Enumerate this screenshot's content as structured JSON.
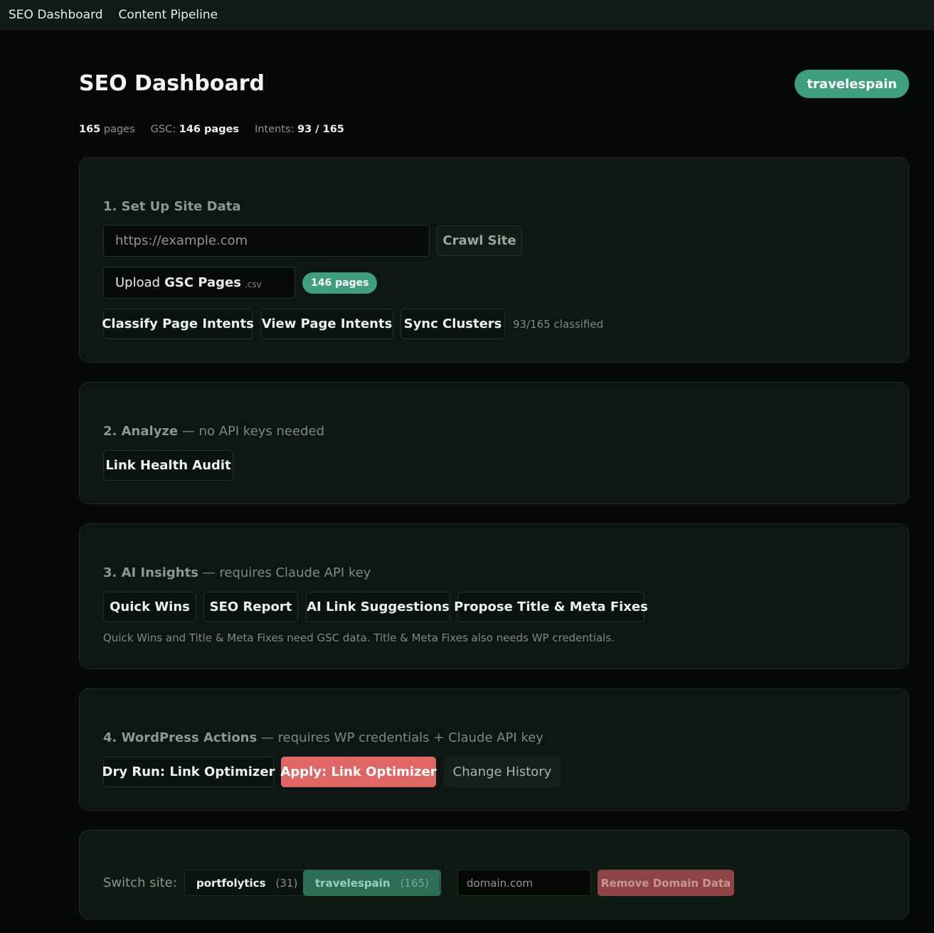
{
  "nav": {
    "items": [
      "SEO Dashboard",
      "Content Pipeline"
    ]
  },
  "header": {
    "title": "SEO Dashboard",
    "site_badge": "travelespain"
  },
  "stats": {
    "pages_count": "165",
    "pages_label": "pages",
    "gsc_label": "GSC:",
    "gsc_value": "146 pages",
    "intents_label": "Intents:",
    "intents_value": "93 / 165"
  },
  "setup": {
    "title": "1. Set Up Site Data",
    "url_placeholder": "https://example.com",
    "crawl_button": "Crawl Site",
    "upload_prefix": "Upload",
    "upload_strong": "GSC Pages",
    "upload_ext": ".csv",
    "pages_badge": "146 pages",
    "classify_button": "Classify Page Intents",
    "view_button": "View Page Intents",
    "sync_button": "Sync Clusters",
    "classified_note": "93/165 classified"
  },
  "analyze": {
    "title": "2. Analyze",
    "subtitle": "— no API keys needed",
    "link_health_button": "Link Health Audit"
  },
  "ai": {
    "title": "3. AI Insights",
    "subtitle": "— requires Claude API key",
    "buttons": [
      "Quick Wins",
      "SEO Report",
      "AI Link Suggestions",
      "Propose Title & Meta Fixes"
    ],
    "note": "Quick Wins and Title & Meta Fixes need GSC data. Title & Meta Fixes also needs WP credentials."
  },
  "wordpress": {
    "title": "4. WordPress Actions",
    "subtitle": "— requires WP credentials + Claude API key",
    "dry_run_button": "Dry Run: Link Optimizer",
    "apply_button": "Apply: Link Optimizer",
    "history_button": "Change History"
  },
  "switcher": {
    "label": "Switch site:",
    "sites": [
      {
        "name": "portfolytics",
        "count": "(31)"
      },
      {
        "name": "travelespain",
        "count": "(165)"
      }
    ],
    "domain_placeholder": "domain.com",
    "remove_button": "Remove Domain Data"
  },
  "colors": {
    "accent": "#3f9e7c",
    "danger": "#e06666",
    "background": "#050907",
    "card": "#0d1612"
  }
}
